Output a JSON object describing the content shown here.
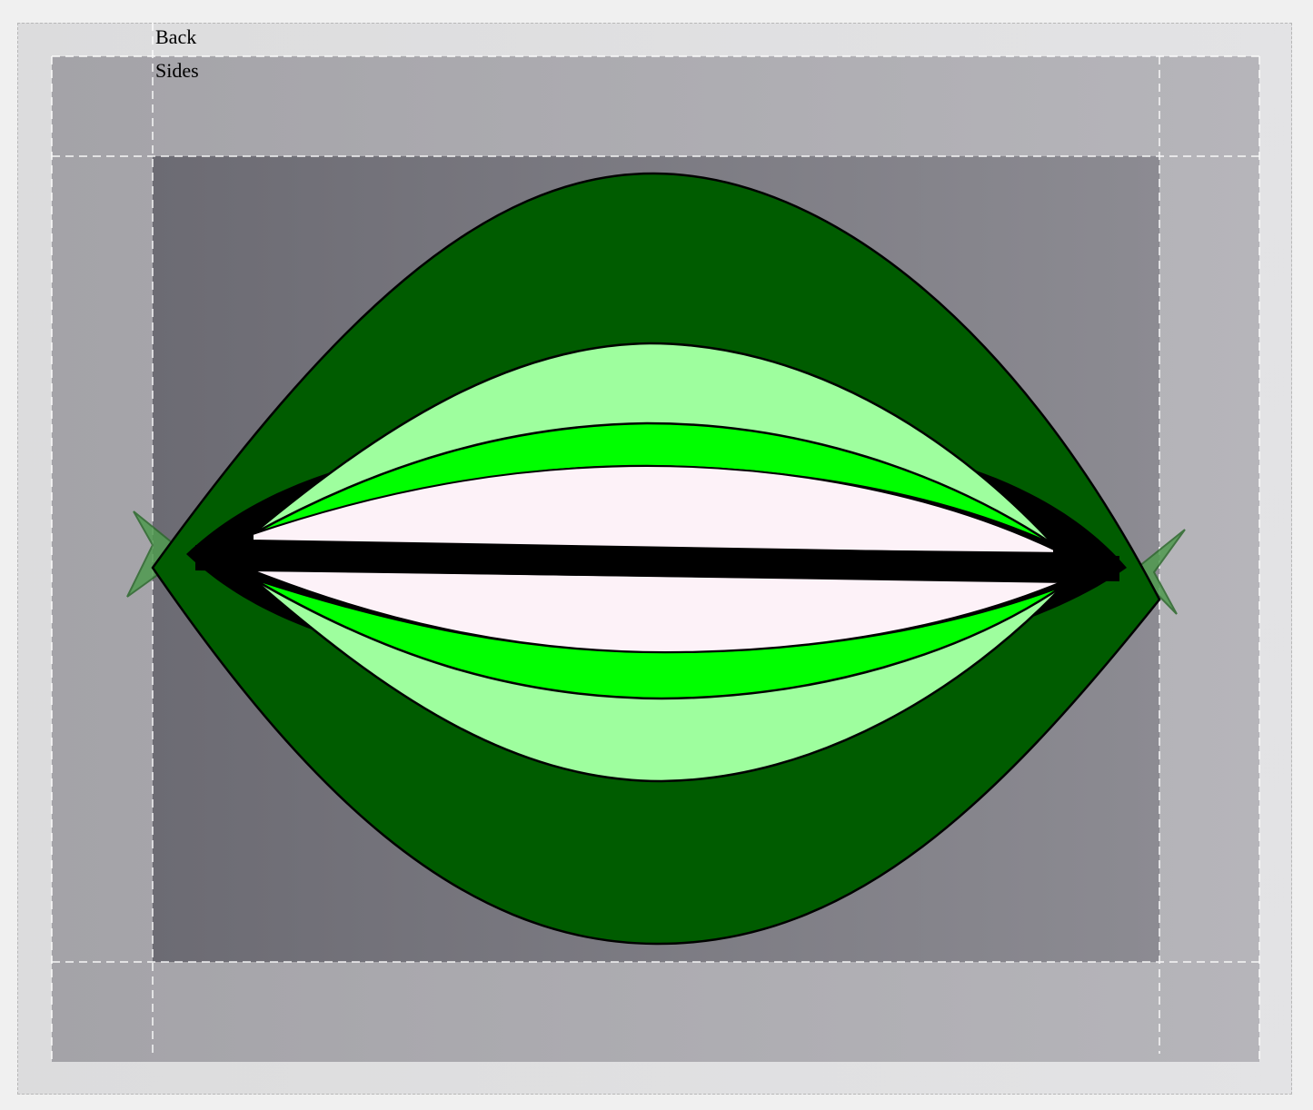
{
  "labels": {
    "back": "Back",
    "sides": "Sides"
  },
  "colors": {
    "page_background": "#f0f0f0",
    "back_region": "#e0e0e1",
    "sides_region": "#acabb0",
    "inner_region": "#7c7b82",
    "guide_line": "#ffffff",
    "outer_leaf": "#005c00",
    "middle_band": "#9efe9e",
    "bright_band": "#00ff00",
    "center_fill": "#fdf2f8",
    "center_bar": "#000000",
    "tip_fins": "#4f9a4f"
  }
}
